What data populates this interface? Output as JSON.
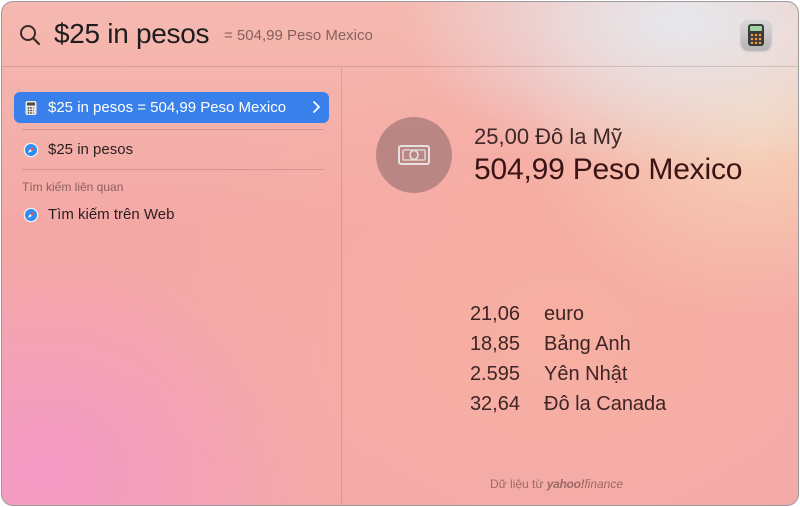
{
  "search": {
    "query": "$25 in pesos",
    "hint": "= 504,99 Peso Mexico"
  },
  "sidebar": {
    "results": [
      {
        "label": "$25 in pesos = 504,99 Peso Mexico",
        "icon": "calculator-icon",
        "selected": true
      },
      {
        "label": "$25 in pesos",
        "icon": "safari-icon",
        "selected": false
      }
    ],
    "section_header": "Tìm kiếm liên quan",
    "related": [
      {
        "label": "Tìm kiếm trên Web",
        "icon": "safari-icon"
      }
    ]
  },
  "detail": {
    "icon": "banknote-icon",
    "from_amount": "25,00 Đô la Mỹ",
    "to_amount": "504,99 Peso Mexico",
    "conversions": [
      {
        "value": "21,06",
        "currency": "euro"
      },
      {
        "value": "18,85",
        "currency": "Bảng Anh"
      },
      {
        "value": "2.595",
        "currency": "Yên Nhật"
      },
      {
        "value": "32,64",
        "currency": "Đô la Canada"
      }
    ],
    "attribution": {
      "prefix": "Dữ liệu từ",
      "brand": "yahoo!",
      "brand_suffix": "finance"
    }
  },
  "colors": {
    "selection": "#3a80ea",
    "to_amount_text": "#3a1414"
  }
}
